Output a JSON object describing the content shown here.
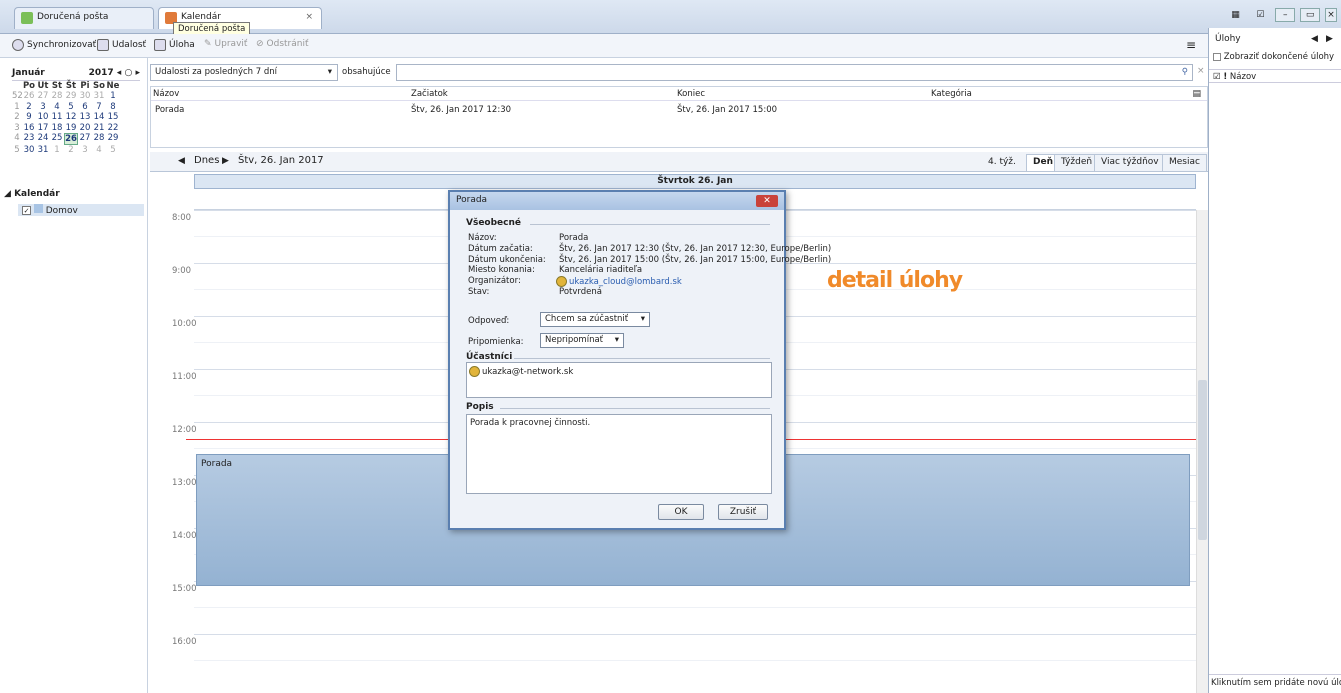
{
  "tabs": [
    {
      "label": "Doručená pošta"
    },
    {
      "label": "Kalendár"
    }
  ],
  "tooltip": "Doručená pošta",
  "toolbar": {
    "sync": "Synchronizovať",
    "event": "Udalosť",
    "task": "Úloha",
    "edit": "Upraviť",
    "delete": "Odstrániť"
  },
  "minical": {
    "month": "Január",
    "year": "2017",
    "weekdays": [
      "Po",
      "Ut",
      "St",
      "Št",
      "Pi",
      "So",
      "Ne"
    ],
    "weeks": [
      {
        "wk": "52",
        "days": [
          "26",
          "27",
          "28",
          "29",
          "30",
          "31",
          "1"
        ]
      },
      {
        "wk": "1",
        "days": [
          "2",
          "3",
          "4",
          "5",
          "6",
          "7",
          "8"
        ]
      },
      {
        "wk": "2",
        "days": [
          "9",
          "10",
          "11",
          "12",
          "13",
          "14",
          "15"
        ]
      },
      {
        "wk": "3",
        "days": [
          "16",
          "17",
          "18",
          "19",
          "20",
          "21",
          "22"
        ]
      },
      {
        "wk": "4",
        "days": [
          "23",
          "24",
          "25",
          "26",
          "27",
          "28",
          "29"
        ]
      },
      {
        "wk": "5",
        "days": [
          "30",
          "31",
          "1",
          "2",
          "3",
          "4",
          "5"
        ]
      }
    ]
  },
  "calendars": {
    "header": "Kalendár",
    "items": [
      {
        "label": "Domov"
      }
    ]
  },
  "filter": {
    "range": "Udalosti za posledných 7 dní",
    "contains": "obsahujúce"
  },
  "list": {
    "headers": {
      "name": "Názov",
      "start": "Začiatok",
      "end": "Koniec",
      "category": "Kategória"
    },
    "rows": [
      {
        "name": "Porada",
        "start": "Štv, 26. Jan 2017 12:30",
        "end": "Štv, 26. Jan 2017 15:00",
        "category": ""
      }
    ]
  },
  "nav": {
    "today": "Dnes",
    "date": "Štv, 26. Jan 2017",
    "week": "4. týž.",
    "views": [
      "Deň",
      "Týždeň",
      "Viac týždňov",
      "Mesiac"
    ]
  },
  "day": {
    "header": "Štvrtok 26. Jan",
    "hours": [
      "8:00",
      "9:00",
      "10:00",
      "11:00",
      "12:00",
      "13:00",
      "14:00",
      "15:00",
      "16:00"
    ],
    "event": "Porada"
  },
  "tasks": {
    "title": "Úlohy",
    "show_completed": "Zobraziť dokončené úlohy",
    "col_name": "Názov",
    "bottom": "Kliknutím sem pridáte novú úlohu"
  },
  "dialog": {
    "title": "Porada",
    "general": "Všeobecné",
    "fields": [
      {
        "label": "Názov:",
        "value": "Porada"
      },
      {
        "label": "Dátum začatia:",
        "value": "Štv, 26. Jan 2017 12:30 (Štv, 26. Jan 2017 12:30, Europe/Berlin)"
      },
      {
        "label": "Dátum ukončenia:",
        "value": "Štv, 26. Jan 2017 15:00 (Štv, 26. Jan 2017 15:00, Europe/Berlin)"
      },
      {
        "label": "Miesto konania:",
        "value": "Kancelária riaditeľa"
      },
      {
        "label": "Organizátor:",
        "value": "ukazka_cloud@lombard.sk"
      },
      {
        "label": "Stav:",
        "value": "Potvrdená"
      }
    ],
    "reply_label": "Odpoveď:",
    "reply_value": "Chcem sa zúčastniť",
    "reminder_label": "Pripomienka:",
    "reminder_value": "Nepripomínať",
    "attendees": "Účastníci",
    "attendee": "ukazka@t-network.sk",
    "description": "Popis",
    "description_text": "Porada k pracovnej činnosti.",
    "ok": "OK",
    "cancel": "Zrušiť"
  },
  "overlay": "detail úlohy"
}
